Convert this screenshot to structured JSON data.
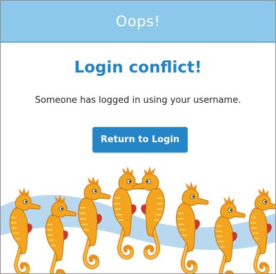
{
  "dialog": {
    "title": "Oops!",
    "heading": "Login conflict!",
    "message": "Someone has logged in using your username.",
    "return_button_label": "Return to Login"
  },
  "colors": {
    "title_bar": "#8cc8ea",
    "heading": "#1e83c6",
    "button": "#2485c7",
    "wave": "#b7d8ee",
    "seahorse_body": "#f3a51f",
    "seahorse_accent": "#c63a2b"
  },
  "decoration": {
    "icon": "seahorse-icon"
  }
}
